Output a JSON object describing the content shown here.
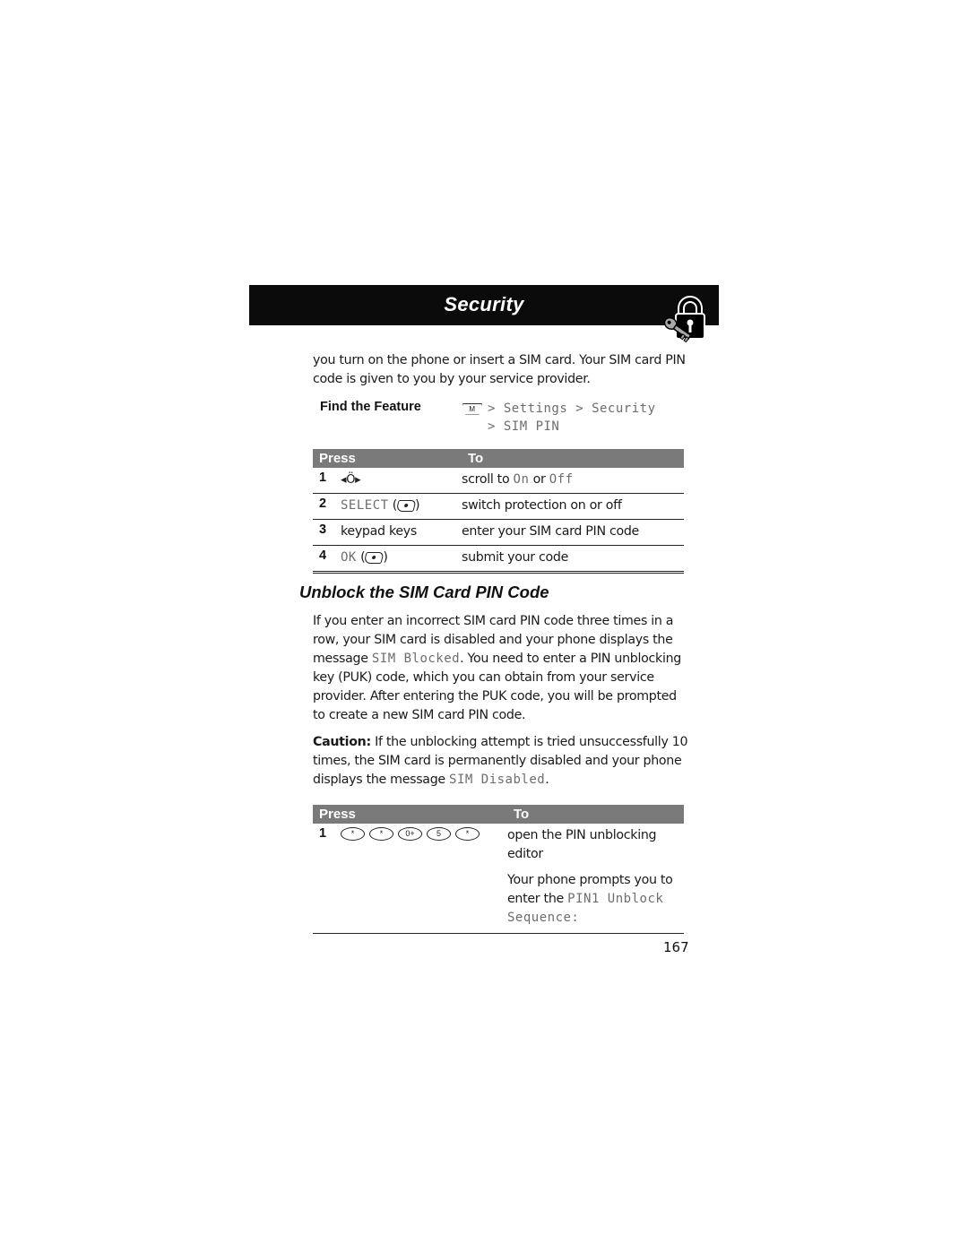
{
  "header": {
    "title": "Security",
    "icon": "lock-and-key-icon"
  },
  "intro_text": "you turn on the phone or insert a SIM card. Your SIM card PIN code is given to you by your service provider.",
  "find_feature": {
    "label": "Find the Feature",
    "menu_key": "M",
    "path_line1": "> Settings > Security",
    "path_line2": "> SIM PIN"
  },
  "table1": {
    "headers": {
      "press": "Press",
      "to": "To"
    },
    "rows": [
      {
        "num": "1",
        "press_icon": "navigation-key-icon",
        "press": "",
        "to_prefix": "scroll to ",
        "to_opt1": "On",
        "to_mid": " or ",
        "to_opt2": "Off"
      },
      {
        "num": "2",
        "press": "SELECT",
        "press_icon": "soft-key-icon",
        "to": "switch protection on or off"
      },
      {
        "num": "3",
        "press": "keypad keys",
        "to": "enter your SIM card PIN code"
      },
      {
        "num": "4",
        "press": "OK",
        "press_icon": "soft-key-icon",
        "to": "submit your code"
      }
    ]
  },
  "section": {
    "title": "Unblock the SIM Card PIN Code",
    "para1_a": "If you enter an incorrect SIM card PIN code three times in a row, your SIM card is disabled and your phone displays the message ",
    "para1_code": "SIM Blocked",
    "para1_b": ". You need to enter a PIN unblocking key (PUK) code, which you can obtain from your service provider. After entering the PUK code, you will be prompted to create a new SIM card PIN code.",
    "caution_label": "Caution:",
    "caution_a": " If the unblocking attempt is tried unsuccessfully 10 times, the SIM card is permanently disabled and your phone displays the message ",
    "caution_code": "SIM Disabled",
    "caution_b": "."
  },
  "table2": {
    "headers": {
      "press": "Press",
      "to": "To"
    },
    "rows": [
      {
        "num": "1",
        "keys": [
          "*",
          "*",
          "0+",
          "5",
          "*"
        ],
        "to": "open the PIN unblocking editor",
        "note_a": "Your phone prompts you to enter the ",
        "note_code": "PIN1 Unblock Sequence:"
      }
    ]
  },
  "page_number": "167"
}
